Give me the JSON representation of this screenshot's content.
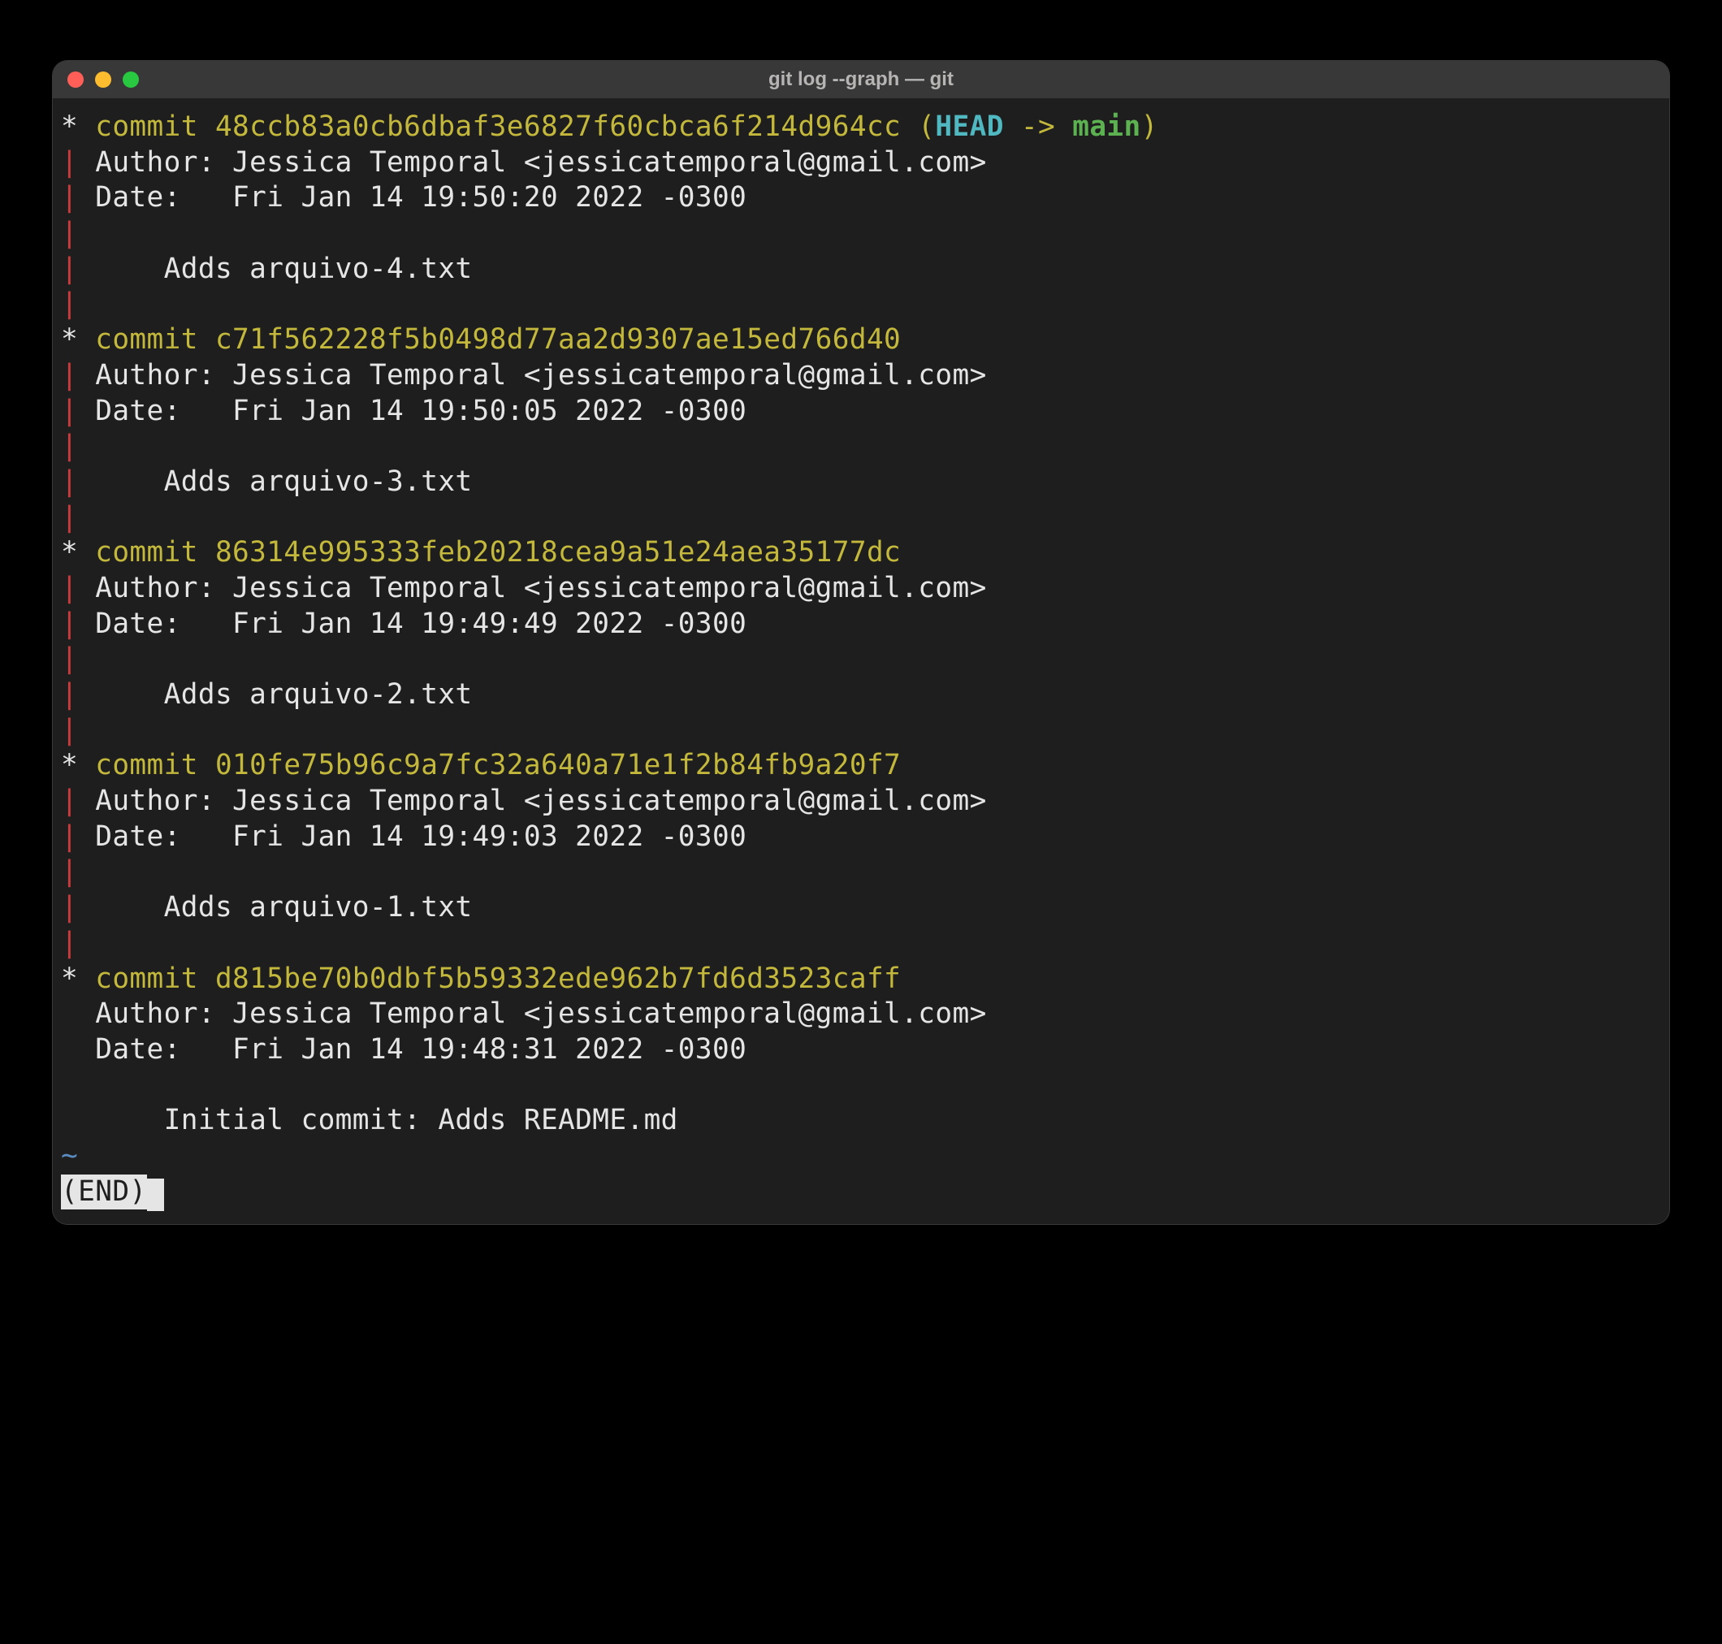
{
  "window": {
    "title": "git log --graph — git"
  },
  "commits": [
    {
      "graph_star": "*",
      "hash": "48ccb83a0cb6dbaf3e6827f60cbca6f214d964cc",
      "ref_head": "HEAD",
      "ref_arrow": " -> ",
      "ref_branch": "main",
      "author": "Author: Jessica Temporal <jessicatemporal@gmail.com>",
      "date": "Date:   Fri Jan 14 19:50:20 2022 -0300",
      "message": "    Adds arquivo-4.txt",
      "has_pipe_after": true
    },
    {
      "graph_star": "*",
      "hash": "c71f562228f5b0498d77aa2d9307ae15ed766d40",
      "author": "Author: Jessica Temporal <jessicatemporal@gmail.com>",
      "date": "Date:   Fri Jan 14 19:50:05 2022 -0300",
      "message": "    Adds arquivo-3.txt",
      "has_pipe_after": true
    },
    {
      "graph_star": "*",
      "hash": "86314e995333feb20218cea9a51e24aea35177dc",
      "author": "Author: Jessica Temporal <jessicatemporal@gmail.com>",
      "date": "Date:   Fri Jan 14 19:49:49 2022 -0300",
      "message": "    Adds arquivo-2.txt",
      "has_pipe_after": true
    },
    {
      "graph_star": "*",
      "hash": "010fe75b96c9a7fc32a640a71e1f2b84fb9a20f7",
      "author": "Author: Jessica Temporal <jessicatemporal@gmail.com>",
      "date": "Date:   Fri Jan 14 19:49:03 2022 -0300",
      "message": "    Adds arquivo-1.txt",
      "has_pipe_after": true
    },
    {
      "graph_star": "*",
      "hash": "d815be70b0dbf5b59332ede962b7fd6d3523caff",
      "author": "Author: Jessica Temporal <jessicatemporal@gmail.com>",
      "date": "Date:   Fri Jan 14 19:48:31 2022 -0300",
      "message": "    Initial commit: Adds README.md",
      "has_pipe_after": false
    }
  ],
  "tilde": "~",
  "end_marker": "(END)",
  "commit_word": "commit ",
  "pipe": "|",
  "space": " ",
  "open_paren": " (",
  "close_paren": ")"
}
